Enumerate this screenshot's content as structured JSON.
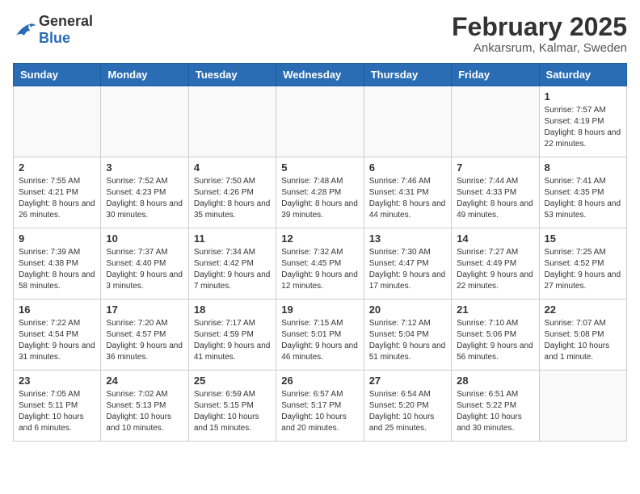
{
  "header": {
    "logo_general": "General",
    "logo_blue": "Blue",
    "title": "February 2025",
    "subtitle": "Ankarsrum, Kalmar, Sweden"
  },
  "calendar": {
    "days_of_week": [
      "Sunday",
      "Monday",
      "Tuesday",
      "Wednesday",
      "Thursday",
      "Friday",
      "Saturday"
    ],
    "weeks": [
      [
        {
          "day": "",
          "detail": ""
        },
        {
          "day": "",
          "detail": ""
        },
        {
          "day": "",
          "detail": ""
        },
        {
          "day": "",
          "detail": ""
        },
        {
          "day": "",
          "detail": ""
        },
        {
          "day": "",
          "detail": ""
        },
        {
          "day": "1",
          "detail": "Sunrise: 7:57 AM\nSunset: 4:19 PM\nDaylight: 8 hours and 22 minutes."
        }
      ],
      [
        {
          "day": "2",
          "detail": "Sunrise: 7:55 AM\nSunset: 4:21 PM\nDaylight: 8 hours and 26 minutes."
        },
        {
          "day": "3",
          "detail": "Sunrise: 7:52 AM\nSunset: 4:23 PM\nDaylight: 8 hours and 30 minutes."
        },
        {
          "day": "4",
          "detail": "Sunrise: 7:50 AM\nSunset: 4:26 PM\nDaylight: 8 hours and 35 minutes."
        },
        {
          "day": "5",
          "detail": "Sunrise: 7:48 AM\nSunset: 4:28 PM\nDaylight: 8 hours and 39 minutes."
        },
        {
          "day": "6",
          "detail": "Sunrise: 7:46 AM\nSunset: 4:31 PM\nDaylight: 8 hours and 44 minutes."
        },
        {
          "day": "7",
          "detail": "Sunrise: 7:44 AM\nSunset: 4:33 PM\nDaylight: 8 hours and 49 minutes."
        },
        {
          "day": "8",
          "detail": "Sunrise: 7:41 AM\nSunset: 4:35 PM\nDaylight: 8 hours and 53 minutes."
        }
      ],
      [
        {
          "day": "9",
          "detail": "Sunrise: 7:39 AM\nSunset: 4:38 PM\nDaylight: 8 hours and 58 minutes."
        },
        {
          "day": "10",
          "detail": "Sunrise: 7:37 AM\nSunset: 4:40 PM\nDaylight: 9 hours and 3 minutes."
        },
        {
          "day": "11",
          "detail": "Sunrise: 7:34 AM\nSunset: 4:42 PM\nDaylight: 9 hours and 7 minutes."
        },
        {
          "day": "12",
          "detail": "Sunrise: 7:32 AM\nSunset: 4:45 PM\nDaylight: 9 hours and 12 minutes."
        },
        {
          "day": "13",
          "detail": "Sunrise: 7:30 AM\nSunset: 4:47 PM\nDaylight: 9 hours and 17 minutes."
        },
        {
          "day": "14",
          "detail": "Sunrise: 7:27 AM\nSunset: 4:49 PM\nDaylight: 9 hours and 22 minutes."
        },
        {
          "day": "15",
          "detail": "Sunrise: 7:25 AM\nSunset: 4:52 PM\nDaylight: 9 hours and 27 minutes."
        }
      ],
      [
        {
          "day": "16",
          "detail": "Sunrise: 7:22 AM\nSunset: 4:54 PM\nDaylight: 9 hours and 31 minutes."
        },
        {
          "day": "17",
          "detail": "Sunrise: 7:20 AM\nSunset: 4:57 PM\nDaylight: 9 hours and 36 minutes."
        },
        {
          "day": "18",
          "detail": "Sunrise: 7:17 AM\nSunset: 4:59 PM\nDaylight: 9 hours and 41 minutes."
        },
        {
          "day": "19",
          "detail": "Sunrise: 7:15 AM\nSunset: 5:01 PM\nDaylight: 9 hours and 46 minutes."
        },
        {
          "day": "20",
          "detail": "Sunrise: 7:12 AM\nSunset: 5:04 PM\nDaylight: 9 hours and 51 minutes."
        },
        {
          "day": "21",
          "detail": "Sunrise: 7:10 AM\nSunset: 5:06 PM\nDaylight: 9 hours and 56 minutes."
        },
        {
          "day": "22",
          "detail": "Sunrise: 7:07 AM\nSunset: 5:08 PM\nDaylight: 10 hours and 1 minute."
        }
      ],
      [
        {
          "day": "23",
          "detail": "Sunrise: 7:05 AM\nSunset: 5:11 PM\nDaylight: 10 hours and 6 minutes."
        },
        {
          "day": "24",
          "detail": "Sunrise: 7:02 AM\nSunset: 5:13 PM\nDaylight: 10 hours and 10 minutes."
        },
        {
          "day": "25",
          "detail": "Sunrise: 6:59 AM\nSunset: 5:15 PM\nDaylight: 10 hours and 15 minutes."
        },
        {
          "day": "26",
          "detail": "Sunrise: 6:57 AM\nSunset: 5:17 PM\nDaylight: 10 hours and 20 minutes."
        },
        {
          "day": "27",
          "detail": "Sunrise: 6:54 AM\nSunset: 5:20 PM\nDaylight: 10 hours and 25 minutes."
        },
        {
          "day": "28",
          "detail": "Sunrise: 6:51 AM\nSunset: 5:22 PM\nDaylight: 10 hours and 30 minutes."
        },
        {
          "day": "",
          "detail": ""
        }
      ]
    ]
  }
}
